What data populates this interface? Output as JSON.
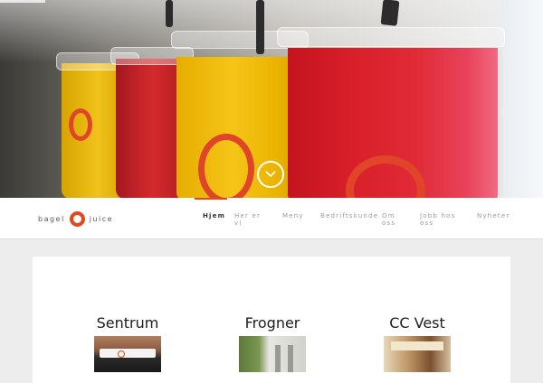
{
  "hero": {
    "scroll_icon": "chevron-down-icon",
    "accent_color": "#e04a1f"
  },
  "brand": {
    "word_left": "bagel",
    "word_right": "juice",
    "logo_icon": "orange-ring-logo"
  },
  "nav": {
    "items": [
      {
        "label": "Hjem",
        "active": true
      },
      {
        "label": "Her er vi"
      },
      {
        "label": "Meny"
      },
      {
        "label": "Bedriftskunde"
      },
      {
        "label": "Om oss"
      },
      {
        "label": "Jobb hos oss"
      },
      {
        "label": "Nyheter"
      }
    ]
  },
  "locations": [
    {
      "name": "Sentrum"
    },
    {
      "name": "Frogner"
    },
    {
      "name": "CC Vest"
    }
  ]
}
